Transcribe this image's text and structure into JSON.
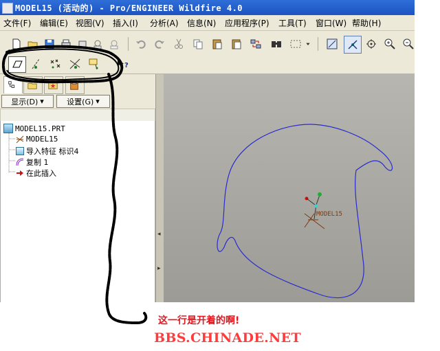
{
  "window": {
    "title": "MODEL15 (活动的) - Pro/ENGINEER Wildfire 4.0"
  },
  "menu": [
    {
      "label": "文件(F)"
    },
    {
      "label": "编辑(E)"
    },
    {
      "label": "视图(V)"
    },
    {
      "label": "插入(I)"
    },
    {
      "label": "分析(A)"
    },
    {
      "label": "信息(N)"
    },
    {
      "label": "应用程序(P)"
    },
    {
      "label": "工具(T)"
    },
    {
      "label": "窗口(W)"
    },
    {
      "label": "帮助(H)"
    }
  ],
  "toolbar_icons": [
    "new-icon",
    "open-icon",
    "save-icon",
    "print-icon",
    "email-icon",
    "email-attach-icon",
    "undo-icon",
    "redo-icon",
    "cut-icon",
    "copy-icon",
    "paste-icon",
    "paste-special-icon",
    "regenerate-icon",
    "find-icon",
    "select-box-icon",
    "dropdown-icon",
    "repaint-icon",
    "spin-center-icon",
    "orient-mode-icon",
    "zoom-in-icon",
    "zoom-out-icon"
  ],
  "datum_toolbar_icons": [
    "datum-plane-icon",
    "datum-axis-icon",
    "datum-point-icon",
    "datum-csys-icon",
    "datum-display-icon",
    "context-help-icon"
  ],
  "panel": {
    "dropdowns": [
      {
        "label": "显示(D)"
      },
      {
        "label": "设置(G)"
      }
    ],
    "tree": [
      {
        "label": "MODEL15.PRT",
        "icon": "part-icon"
      },
      {
        "label": "MODEL15",
        "icon": "csys-icon"
      },
      {
        "label": "导入特征 标识4",
        "icon": "import-feature-icon"
      },
      {
        "label": "复制 1",
        "icon": "copy-feature-icon"
      },
      {
        "label": "在此插入",
        "icon": "insert-here-arrow-icon"
      }
    ]
  },
  "viewport": {
    "csys_label": "MODEL15",
    "curve_color": "#2a2ad0",
    "background": "#ababa5"
  },
  "annotation": {
    "text": "这一行是开着的啊!",
    "color": "#e4171f"
  },
  "watermark": {
    "text": "BBS.CHINADE.NET",
    "color": "#ff3b3b"
  }
}
